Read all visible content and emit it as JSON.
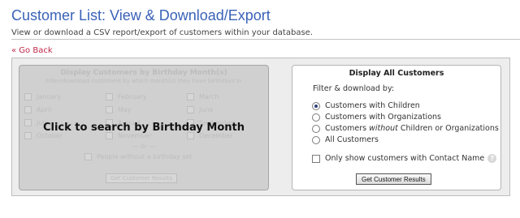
{
  "header": {
    "title": "Customer List: View & Download/Export",
    "subtitle": "View or download a CSV report/export of customers within your database."
  },
  "nav": {
    "back_label": "« Go Back"
  },
  "birthday_panel": {
    "title": "Display Customers by Birthday Month(s)",
    "subtitle": "Filter/download customers by which month(s) they have birthdays in",
    "months": [
      "January",
      "February",
      "March",
      "April",
      "May",
      "June",
      "July",
      "August",
      "September",
      "October",
      "November",
      "December"
    ],
    "or_label": "— or —",
    "no_birthday_label": "People without a birthday set",
    "button_label": "Get Customer Results",
    "overlay_label": "Click to search by Birthday Month"
  },
  "all_customers_panel": {
    "title": "Display All Customers",
    "filter_label": "Filter & download by:",
    "options": {
      "children": "Customers with Children",
      "organizations": "Customers with Organizations",
      "without_prefix": "Customers ",
      "without_em": "without",
      "without_suffix": " Children or Organizations",
      "all": "All Customers"
    },
    "selected_option": "children",
    "contact_name_label": "Only show customers with Contact Name",
    "help_icon": "question-mark-icon",
    "button_label": "Get Customer Results"
  },
  "colors": {
    "title": "#3a62b8",
    "back_link": "#c0294a",
    "panel_bg": "#ededed",
    "disabled_panel": "#d0d0d0"
  }
}
